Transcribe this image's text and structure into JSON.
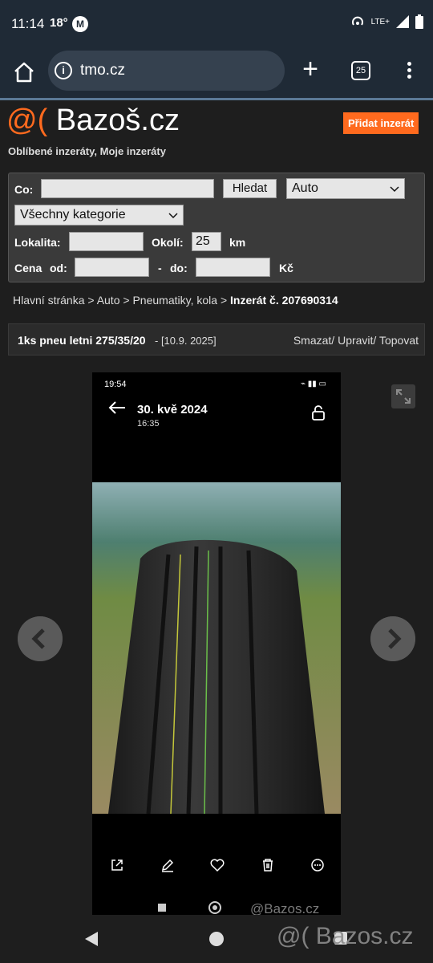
{
  "status": {
    "time": "11:14",
    "temp": "18°",
    "network": "LTE+"
  },
  "browser": {
    "url": "tmo.cz",
    "tab_count": "25"
  },
  "site": {
    "logo_at": "@(",
    "logo_text": "Bazoš.cz",
    "add_button": "Přidat inzerát",
    "fav_links": "Oblíbené inzeráty, Moje inzeráty"
  },
  "search": {
    "co_label": "Co:",
    "co_value": "",
    "search_button": "Hledat",
    "section_select": "Auto",
    "category_select": "Všechny kategorie",
    "locality_label": "Lokalita:",
    "locality_value": "",
    "radius_label": "Okolí:",
    "radius_value": "25",
    "km_label": "km",
    "price_label": "Cena",
    "from_label": "od:",
    "dash": "-",
    "to_label": "do:",
    "currency": "Kč"
  },
  "breadcrumb": {
    "home": "Hlavní stránka",
    "sep": ">",
    "section": "Auto",
    "category": "Pneumatiky, kola",
    "current": "Inzerát č. 207690314"
  },
  "ad": {
    "title": "1ks pneu letni 275/35/20",
    "date": "- [10.9. 2025]",
    "actions": "Smazat/ Upravit/ Topovat"
  },
  "photo": {
    "status_time": "19:54",
    "date": "30. kvě 2024",
    "time": "16:35",
    "watermark_small": "@Bazos.cz"
  },
  "watermark": "@( Bazos.cz"
}
